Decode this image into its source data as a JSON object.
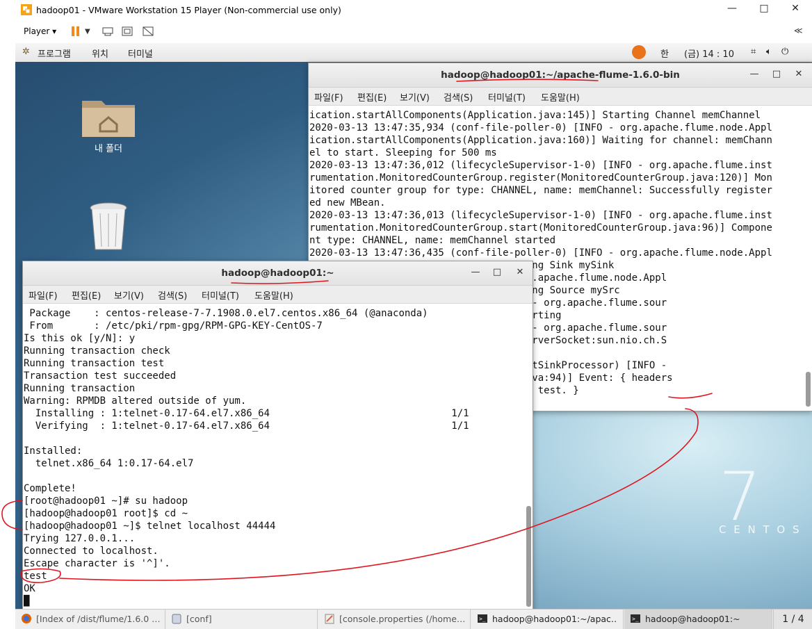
{
  "vm": {
    "title": "hadoop01 - VMware Workstation 15 Player (Non-commercial use only)",
    "player_label": "Player ▾",
    "collapse_glyph": "≪",
    "minimize": "—",
    "maximize": "□",
    "close": "✕"
  },
  "gnome": {
    "menu_programs": "프로그램",
    "menu_places": "위치",
    "menu_terminal": "터미널",
    "lang": "한",
    "clock": "(금) 14 : 10"
  },
  "desktop": {
    "icons": [
      {
        "label": "내 폴더"
      },
      {
        "label": ""
      }
    ],
    "centos_seven": "7",
    "centos_word": "C E N T O S"
  },
  "term_flume": {
    "title": "hadoop@hadoop01:~/apache-flume-1.6.0-bin",
    "menu": [
      "파일(F)",
      "편집(E)",
      "보기(V)",
      "검색(S)",
      "터미널(T)",
      "도움말(H)"
    ],
    "lines": [
      "ication.startAllComponents(Application.java:145)] Starting Channel memChannel",
      "2020-03-13 13:47:35,934 (conf-file-poller-0) [INFO - org.apache.flume.node.Appl",
      "ication.startAllComponents(Application.java:160)] Waiting for channel: memChann",
      "el to start. Sleeping for 500 ms",
      "2020-03-13 13:47:36,012 (lifecycleSupervisor-1-0) [INFO - org.apache.flume.inst",
      "rumentation.MonitoredCounterGroup.register(MonitoredCounterGroup.java:120)] Mon",
      "itored counter group for type: CHANNEL, name: memChannel: Successfully register",
      "ed new MBean.",
      "2020-03-13 13:47:36,013 (lifecycleSupervisor-1-0) [INFO - org.apache.flume.inst",
      "rumentation.MonitoredCounterGroup.start(MonitoredCounterGroup.java:96)] Compone",
      "nt type: CHANNEL, name: memChannel started",
      "2020-03-13 13:47:36,435 (conf-file-poller-0) [INFO - org.apache.flume.node.Appl",
      "                  on.java:173)] Starting Sink mySink",
      "                  oller-0) [INFO - org.apache.flume.node.Appl",
      "                  on.java:184)] Starting Source mySrc",
      "                  pervisor-1-4) [INFO - org.apache.flume.sour",
      "                  ava:150)] Source starting",
      "                  pervisor-1-4) [INFO - org.apache.flume.sour",
      "                  ava:164)] Created serverSocket:sun.nio.ch.S",
      "                  444]",
      "                  PollingRunner-DefaultSinkProcessor) [INFO -",
      "                  rocess(LoggerSink.java:94)] Event: { headers",
      "                                       test. }"
    ]
  },
  "term_home": {
    "title": "hadoop@hadoop01:~",
    "menu": [
      "파일(F)",
      "편집(E)",
      "보기(V)",
      "검색(S)",
      "터미널(T)",
      "도움말(H)"
    ],
    "lines": [
      " Package    : centos-release-7-7.1908.0.el7.centos.x86_64 (@anaconda)",
      " From       : /etc/pki/rpm-gpg/RPM-GPG-KEY-CentOS-7",
      "Is this ok [y/N]: y",
      "Running transaction check",
      "Running transaction test",
      "Transaction test succeeded",
      "Running transaction",
      "Warning: RPMDB altered outside of yum.",
      "  Installing : 1:telnet-0.17-64.el7.x86_64                               1/1",
      "  Verifying  : 1:telnet-0.17-64.el7.x86_64                               1/1",
      "",
      "Installed:",
      "  telnet.x86_64 1:0.17-64.el7",
      "",
      "Complete!",
      "[root@hadoop01 ~]# su hadoop",
      "[hadoop@hadoop01 root]$ cd ~",
      "[hadoop@hadoop01 ~]$ telnet localhost 44444",
      "Trying 127.0.0.1...",
      "Connected to localhost.",
      "Escape character is '^]'.",
      "test",
      "OK",
      "█"
    ]
  },
  "taskbar": {
    "items": [
      {
        "label": "[Index of /dist/flume/1.6.0 …",
        "icon": "firefox-icon"
      },
      {
        "label": "[conf]",
        "icon": "folder-icon"
      },
      {
        "label": "[console.properties (/home…",
        "icon": "editor-icon"
      },
      {
        "label": "hadoop@hadoop01:~/apac…",
        "icon": "terminal-icon"
      },
      {
        "label": "hadoop@hadoop01:~",
        "icon": "terminal-icon"
      }
    ],
    "workspace": "1 / 4"
  },
  "colors": {
    "annotation_red": "#e0141e",
    "desktop_blue": "#2f5d82"
  }
}
